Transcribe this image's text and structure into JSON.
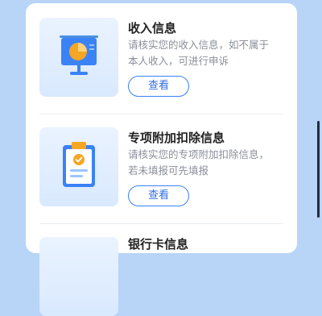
{
  "sections": [
    {
      "title": "收入信息",
      "desc_lines": [
        "请核实您的收入信息，如不属于",
        "本人收入，可进行申诉"
      ],
      "button_label": "查看",
      "icon": "presentation-chart-icon"
    },
    {
      "title": "专项附加扣除信息",
      "desc_lines": [
        "请核实您的专项附加扣除信息，",
        "若未填报可先填报"
      ],
      "button_label": "查看",
      "icon": "clipboard-check-icon"
    },
    {
      "title": "银行卡信息",
      "icon": "bank-card-icon"
    }
  ],
  "colors": {
    "accent": "#3b82f6",
    "background": "#b8d4f6",
    "icon_orange": "#f5a623"
  }
}
